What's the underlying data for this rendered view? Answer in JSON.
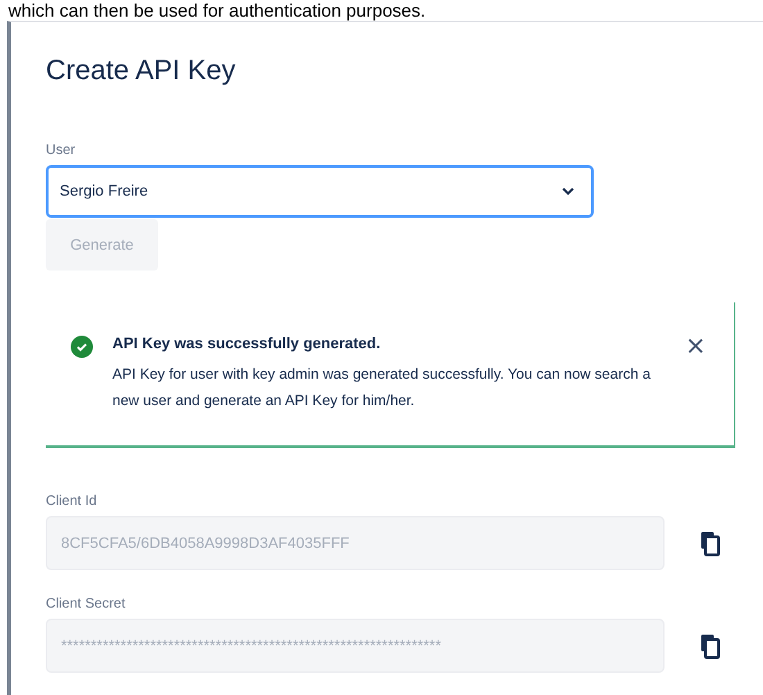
{
  "intro_text": "which can then be used for authentication purposes.",
  "dialog": {
    "title": "Create API Key",
    "user_field": {
      "label": "User",
      "value": "Sergio Freire",
      "focused": true
    },
    "generate_button": {
      "label": "Generate",
      "disabled": true
    },
    "alert": {
      "kind": "success",
      "title": "API Key was successfully generated.",
      "message": "API Key for user with key admin was generated successfully. You can now search a new user and generate an API Key for him/her.",
      "close": "×"
    },
    "fields": [
      {
        "label": "Client Id",
        "value": "8CF5CFA5/6DB4058A9998D3AF4035FFF"
      },
      {
        "label": "Client Secret",
        "value": "****************************************************************"
      }
    ]
  }
}
